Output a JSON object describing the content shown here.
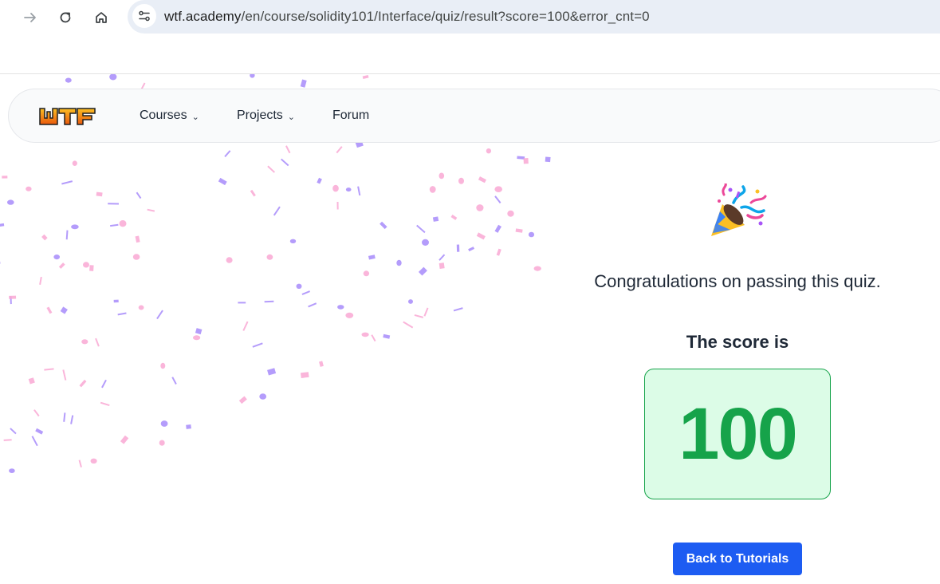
{
  "browser": {
    "url_host": "wtf.academy",
    "url_path": "/en/course/solidity101/Interface/quiz/result?score=100&error_cnt=0",
    "icons": [
      "forward-arrow-icon",
      "reload-icon",
      "home-icon",
      "site-settings-icon"
    ]
  },
  "nav": {
    "logo_text": "WTF",
    "items": [
      {
        "label": "Courses",
        "has_dropdown": true
      },
      {
        "label": "Projects",
        "has_dropdown": true
      },
      {
        "label": "Forum",
        "has_dropdown": false
      }
    ]
  },
  "result": {
    "emoji_icon": "party-popper-icon",
    "congrats": "Congratulations on passing this quiz.",
    "score_label": "The score is",
    "score": "100",
    "back_button": "Back to Tutorials"
  },
  "colors": {
    "score_green": "#16a34a",
    "score_bg": "#dcfce7",
    "button_blue": "#1d5cf2",
    "confetti_pink": "#f9a8d4",
    "confetti_purple": "#a78bfa"
  }
}
